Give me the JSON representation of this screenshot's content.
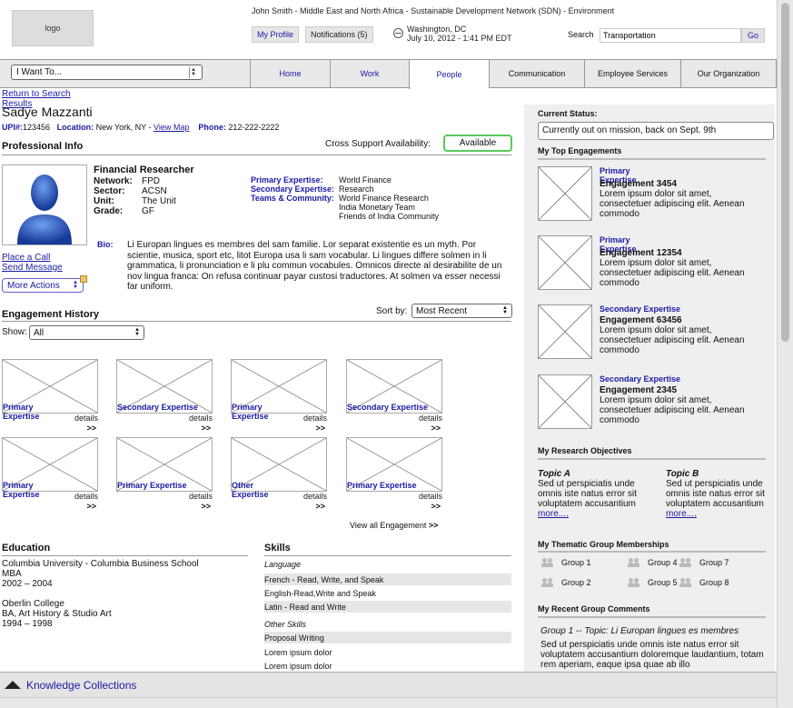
{
  "header": {
    "logo": "logo",
    "user_line": "John Smith - Middle East and North Africa - Sustainable Development Network (SDN) - Environment",
    "my_profile": "My Profile",
    "notifications": "Notifications (5)",
    "location_city": "Washington, DC",
    "location_datetime": "July 10, 2012 - 1:41 PM EDT",
    "search_label": "Search",
    "search_value": "Transportation",
    "search_go": "Go"
  },
  "nav": {
    "i_want_to": "I Want To...",
    "tabs": [
      "Home",
      "Work",
      "People",
      "Communication",
      "Employee Services",
      "Our Organization"
    ],
    "active_tab": "People"
  },
  "profile": {
    "return_link": "Return to Search",
    "results_link": "Results",
    "name": "Sadye Mazzanti",
    "upi_label": "UPI#:",
    "upi": "123456",
    "location_label": "Location:",
    "location": "New York, NY -",
    "view_map": "View Map",
    "phone_label": "Phone:",
    "phone": "212-222-2222",
    "professional_info": "Professional Info",
    "cross_support_label": "Cross Support Availability:",
    "availability": "Available",
    "title": "Financial Researcher",
    "network_label": "Network:",
    "network": "FPD",
    "sector_label": "Sector:",
    "sector": "ACSN",
    "unit_label": "Unit:",
    "unit": "The Unit",
    "grade_label": "Grade:",
    "grade": "GF",
    "primary_expertise_label": "Primary Expertise:",
    "primary_expertise": "World Finance",
    "secondary_expertise_label": "Secondary Expertise:",
    "secondary_expertise": "Research",
    "teams_label": "Teams & Community:",
    "teams": [
      "World Finance Research",
      "India Monetary Team",
      "Friends of India Community"
    ],
    "bio_label": "Bio:",
    "bio": "Li Europan lingues es membres del sam familie. Lor separat existentie es un myth. Por scientie, musica, sport etc, litot Europa usa li sam vocabular. Li lingues differe solmen in li grammatica, li pronunciation e li plu commun vocabules. Omnicos directe al desirabilite de un nov lingua franca: On refusa continuar payar custosi traductores. At solmen va esser necessi far uniform.",
    "place_call": "Place a Call",
    "send_message": "Send Message",
    "more_actions": "More Actions"
  },
  "engagement_history": {
    "title": "Engagement History",
    "sort_label": "Sort by:",
    "sort_value": "Most Recent",
    "show_label": "Show:",
    "show_value": "All",
    "details": "details",
    "more": ">>",
    "items": [
      {
        "label": "Primary Expertise"
      },
      {
        "label": "Secondary Expertise"
      },
      {
        "label": "Primary Expertise"
      },
      {
        "label": "Secondary Expertise"
      },
      {
        "label": "Primary Expertise"
      },
      {
        "label": "Primary Expertise"
      },
      {
        "label": "Other Expertise"
      },
      {
        "label": "Primary Expertise"
      }
    ],
    "view_all": "View all Engagement"
  },
  "education": {
    "title": "Education",
    "entries": [
      {
        "school": "Columbia University - Columbia Business School",
        "degree": "MBA",
        "years": "2002 – 2004"
      },
      {
        "school": "Oberlin College",
        "degree": "BA, Art History & Studio Art",
        "years": "1994 – 1998"
      }
    ]
  },
  "skills": {
    "title": "Skills",
    "language_label": "Language",
    "languages": [
      "French - Read, Write, and Speak",
      "English-Read,Write and Speak",
      "Latin - Read and Write"
    ],
    "other_label": "Other Skills",
    "other": [
      "Proposal Writing",
      "Lorem ipsum dolor",
      "Lorem ipsum dolor"
    ]
  },
  "right": {
    "current_status_label": "Current Status:",
    "current_status": "Currently out on mission, back on Sept. 9th",
    "top_engagements_title": "My Top Engagements",
    "top_engagements": [
      {
        "type": "Primary Expertise",
        "name": "Engagement 3454",
        "desc": "Lorem ipsum dolor sit amet, consectetuer adipiscing elit. Aenean commodo"
      },
      {
        "type": "Primary Expertise",
        "name": "Engagement 12354",
        "desc": "Lorem ipsum dolor sit amet, consectetuer adipiscing elit. Aenean commodo"
      },
      {
        "type": "Secondary Expertise",
        "name": "Engagement 63456",
        "desc": "Lorem ipsum dolor sit amet, consectetuer adipiscing elit. Aenean commodo"
      },
      {
        "type": "Secondary Expertise",
        "name": "Engagement 2345",
        "desc": "Lorem ipsum dolor sit amet, consectetuer adipiscing elit. Aenean commodo"
      }
    ],
    "research_title": "My Research Objectives",
    "topics": [
      {
        "title": "Topic A",
        "text": "Sed ut perspiciatis unde omnis iste natus error sit voluptatem accusantium",
        "more": "more...."
      },
      {
        "title": "Topic B",
        "text": "Sed ut perspiciatis unde omnis iste natus error sit voluptatem accusantium",
        "more": "more...."
      }
    ],
    "groups_title": "My Thematic Group Memberships",
    "groups": [
      "Group 1",
      "Group 4",
      "Group 7",
      "Group 2",
      "Group 5",
      "Group 8"
    ],
    "comments_title": "My Recent Group Comments",
    "comment_heading": "Group 1 -- Topic: Li Europan lingues es membres",
    "comment_text": "Sed ut perspiciatis unde omnis iste natus error sit voluptatem accusantium doloremque laudantium, totam rem aperiam, eaque ipsa quae ab illo"
  },
  "footer": {
    "knowledge_collections": "Knowledge Collections"
  }
}
